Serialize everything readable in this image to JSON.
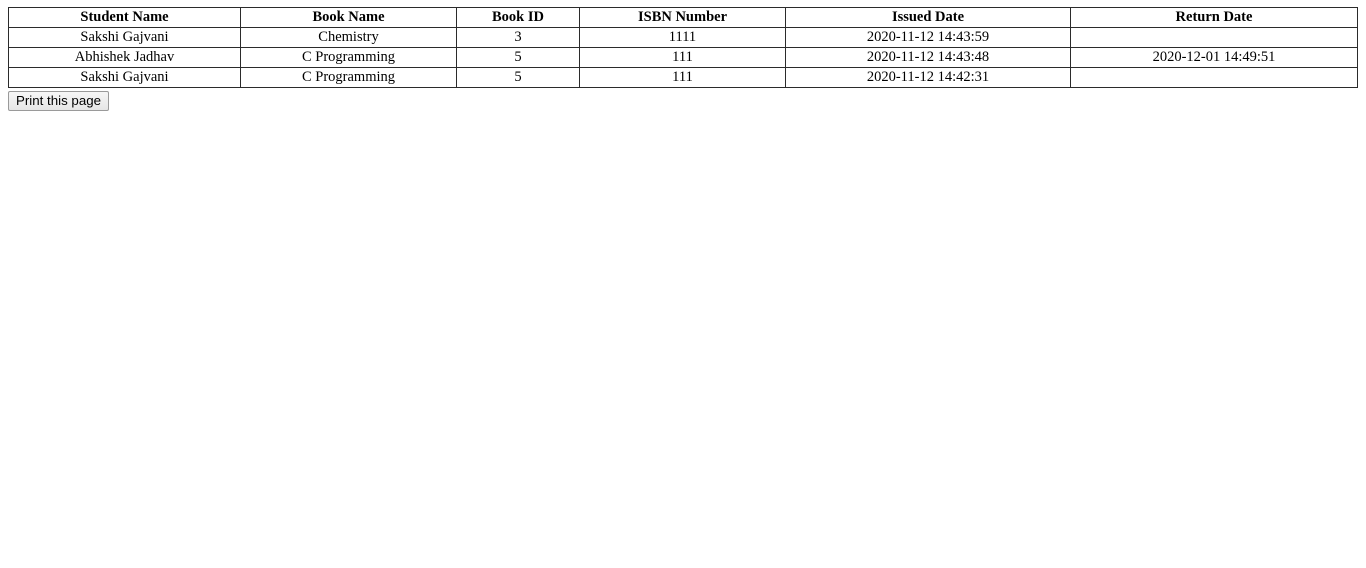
{
  "table": {
    "columns": [
      {
        "key": "student_name",
        "label": "Student Name"
      },
      {
        "key": "book_name",
        "label": "Book Name"
      },
      {
        "key": "book_id",
        "label": "Book ID"
      },
      {
        "key": "isbn_number",
        "label": "ISBN Number"
      },
      {
        "key": "issued_date",
        "label": "Issued Date"
      },
      {
        "key": "return_date",
        "label": "Return Date"
      }
    ],
    "rows": [
      {
        "student_name": "Sakshi Gajvani",
        "book_name": "Chemistry",
        "book_id": "3",
        "isbn_number": "1111",
        "issued_date": "2020-11-12 14:43:59",
        "return_date": ""
      },
      {
        "student_name": "Abhishek Jadhav",
        "book_name": "C Programming",
        "book_id": "5",
        "isbn_number": "111",
        "issued_date": "2020-11-12 14:43:48",
        "return_date": "2020-12-01 14:49:51"
      },
      {
        "student_name": "Sakshi Gajvani",
        "book_name": "C Programming",
        "book_id": "5",
        "isbn_number": "111",
        "issued_date": "2020-11-12 14:42:31",
        "return_date": ""
      }
    ]
  },
  "actions": {
    "print_label": "Print this page"
  },
  "colors": {
    "border": "#2b2b2b",
    "text": "#000000",
    "background": "#ffffff",
    "button_face": "#efefef",
    "button_border": "#9a9a9a"
  }
}
